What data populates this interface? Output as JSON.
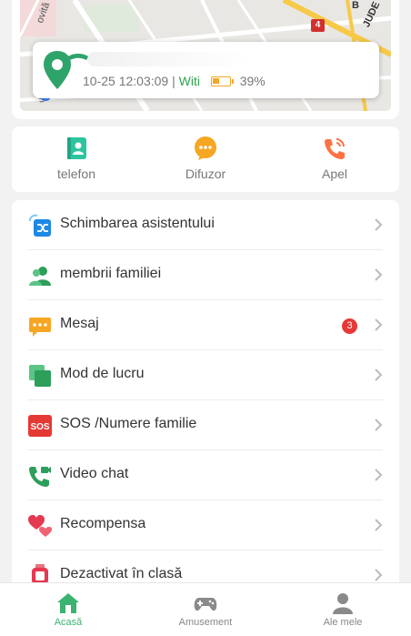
{
  "map": {
    "street_label_left": "ovită",
    "street_label_right": "JUDE",
    "street_label_b": "B",
    "route_number": "4",
    "map_corner_text": "Str",
    "device_time": "10-25 12:03:09",
    "separator": "|",
    "connection": "Witi",
    "battery_percent": "39%",
    "battery_level": 0.39
  },
  "quick_actions": [
    {
      "label": "telefon",
      "icon": "contact-book-icon"
    },
    {
      "label": "Difuzor",
      "icon": "speaker-chat-icon"
    },
    {
      "label": "Apel",
      "icon": "phone-call-icon"
    }
  ],
  "menu": [
    {
      "label": "Schimbarea asistentului",
      "icon": "switch-device-icon"
    },
    {
      "label": "membrii familiei",
      "icon": "family-members-icon"
    },
    {
      "label": "Mesaj",
      "icon": "message-icon",
      "badge": "3"
    },
    {
      "label": "Mod de lucru",
      "icon": "work-mode-icon"
    },
    {
      "label": "SOS /Numere familie",
      "icon": "sos-icon",
      "icon_text": "SOS"
    },
    {
      "label": "Video chat",
      "icon": "video-call-icon"
    },
    {
      "label": "Recompensa",
      "icon": "hearts-icon"
    },
    {
      "label": "Dezactivat în clasă",
      "icon": "watch-icon"
    }
  ],
  "nav": [
    {
      "label": "Acasă",
      "icon": "home-icon",
      "active": true
    },
    {
      "label": "Amusement",
      "icon": "gamepad-icon",
      "active": false
    },
    {
      "label": "Ale mele",
      "icon": "person-icon",
      "active": false
    }
  ],
  "colors": {
    "accent_green": "#3cb371",
    "badge_red": "#e53935",
    "battery_orange": "#f5a623",
    "wifi_green": "#2ea44f"
  }
}
